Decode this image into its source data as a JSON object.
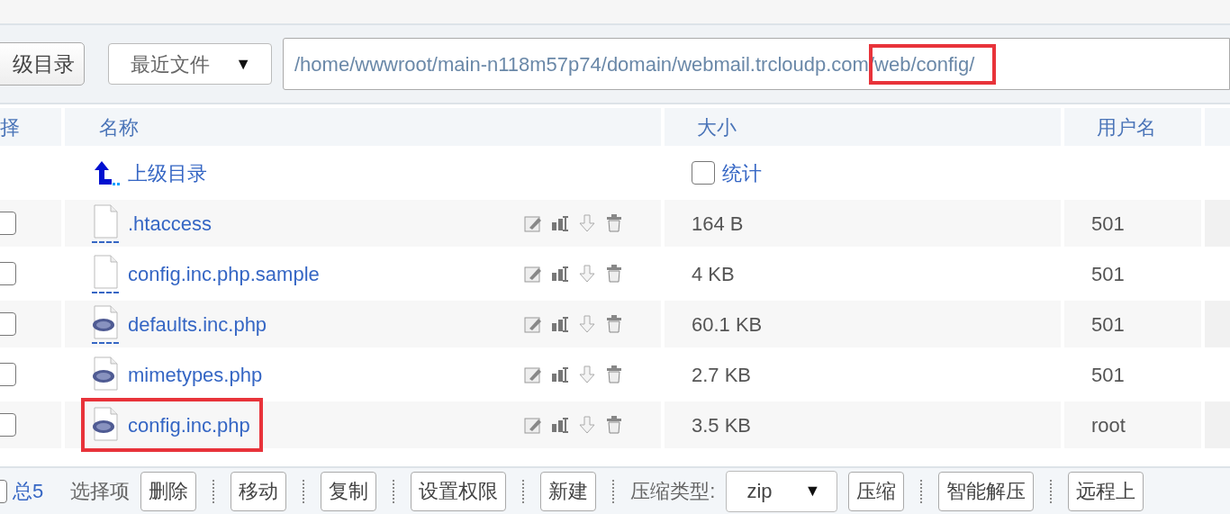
{
  "toolbar": {
    "up_button": "级目录",
    "recent": {
      "label": "最近文件",
      "caret": "▼"
    },
    "path": [
      {
        "text": "/home/wwwroot/main-n118m57p74/domain/webmail.trcloudp.com",
        "highlighted": false
      },
      {
        "text": "/web/config/",
        "highlighted": true
      }
    ]
  },
  "table": {
    "columns": [
      "择",
      "名称",
      "大小",
      "用户名"
    ],
    "parent_row": {
      "label": "上级目录",
      "stat": {
        "label": "统计",
        "checked": false
      }
    },
    "rows": [
      {
        "name": ".htaccess",
        "kind": "file",
        "underlined": true,
        "size": "164 B",
        "user": "501",
        "checked": false,
        "highlighted": false
      },
      {
        "name": "config.inc.php.sample",
        "kind": "file",
        "underlined": true,
        "size": "4 KB",
        "user": "501",
        "checked": false,
        "highlighted": false
      },
      {
        "name": "defaults.inc.php",
        "kind": "php",
        "underlined": true,
        "size": "60.1 KB",
        "user": "501",
        "checked": false,
        "highlighted": false
      },
      {
        "name": "mimetypes.php",
        "kind": "php",
        "underlined": false,
        "size": "2.7 KB",
        "user": "501",
        "checked": false,
        "highlighted": false
      },
      {
        "name": "config.inc.php",
        "kind": "php",
        "underlined": false,
        "size": "3.5 KB",
        "user": "root",
        "checked": false,
        "highlighted": true
      }
    ]
  },
  "footer": {
    "select_all": {
      "checked": false
    },
    "total": "总5",
    "selection_label": "选择项",
    "items": [
      {
        "kind": "button",
        "label": "删除"
      },
      {
        "kind": "button",
        "label": "移动"
      },
      {
        "kind": "button",
        "label": "复制"
      },
      {
        "kind": "button",
        "label": "设置权限"
      },
      {
        "kind": "button",
        "label": "新建"
      },
      {
        "kind": "label",
        "label": "压缩类型:"
      },
      {
        "kind": "select",
        "label": "zip",
        "caret": "▼"
      },
      {
        "kind": "button",
        "label": "压缩"
      },
      {
        "kind": "button",
        "label": "智能解压"
      },
      {
        "kind": "button",
        "label": "远程上"
      }
    ]
  }
}
